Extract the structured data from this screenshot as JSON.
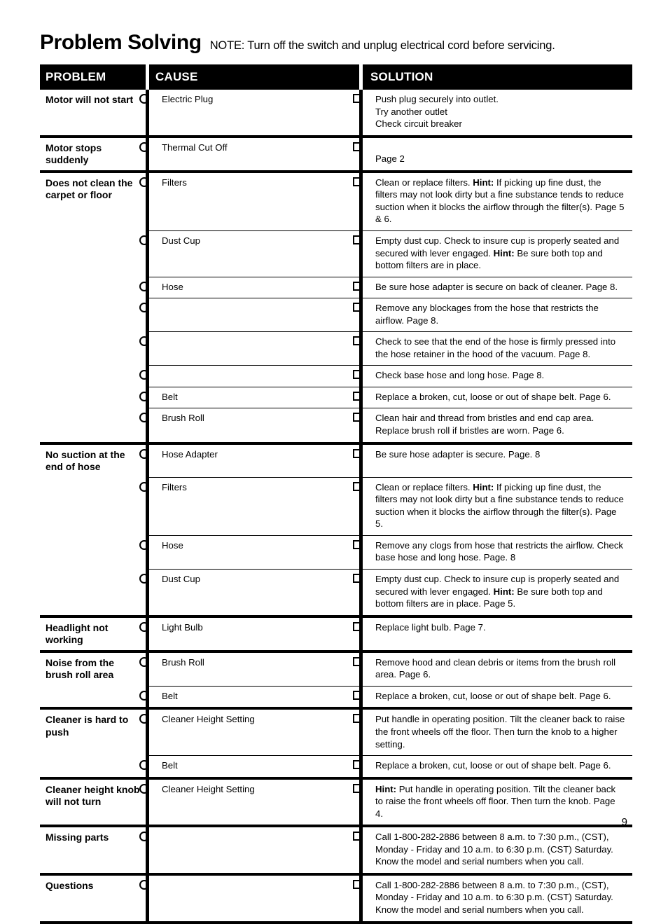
{
  "document": {
    "title": "Problem Solving",
    "note": "NOTE: Turn off the switch and unplug electrical cord before servicing.",
    "page_number": "9"
  },
  "table": {
    "headers": {
      "problem": "PROBLEM",
      "cause": "CAUSE",
      "solution": "SOLUTION"
    },
    "groups": [
      {
        "problem": "Motor will not start",
        "rows": [
          {
            "cause": "Electric Plug",
            "solution": "Push plug securely into outlet.\nTry another outlet\nCheck circuit breaker",
            "min_height": 56
          }
        ]
      },
      {
        "problem": "Motor stops suddenly",
        "rows": [
          {
            "cause": "Thermal Cut Off",
            "solution_lead": "",
            "solution": "Page 2",
            "min_height": 46,
            "solution_offset": true
          }
        ]
      },
      {
        "problem": "Does not clean the carpet or floor",
        "rows": [
          {
            "cause": "Filters",
            "solution_html": "Clean or replace filters. <b>Hint:</b> If picking up fine dust, the filters may not look dirty but a fine substance tends to reduce suction when it blocks the airflow through the filter(s). Page 5 &amp; 6.",
            "min_height": 59
          },
          {
            "cause": "Dust Cup",
            "solution_html": "Empty dust cup. Check to insure cup is properly seated and secured with lever engaged. <b>Hint:</b> Be sure both top and bottom filters are in place.",
            "min_height": 56
          },
          {
            "cause": "Hose",
            "solution_html": "Be sure hose adapter is secure on back of cleaner. Page 8.",
            "min_height": 28
          },
          {
            "cause": "",
            "solution_html": "Remove any blockages from the hose that restricts the airflow. Page 8.",
            "min_height": 37
          },
          {
            "cause": "",
            "solution_html": "Check to see that the end of the hose is firmly pressed into the hose retainer in the hood of the vacuum. Page 8.",
            "min_height": 38
          },
          {
            "cause": "",
            "solution_html": "Check base hose and long hose. Page 8.",
            "min_height": 26
          },
          {
            "cause": "Belt",
            "solution_html": "Replace a broken, cut, loose or out of shape belt. Page 6.",
            "min_height": 23
          },
          {
            "cause": "Brush Roll",
            "solution_html": "Clean hair and thread from bristles and end cap area. Replace brush roll if bristles are worn. Page 6.",
            "min_height": 44
          }
        ]
      },
      {
        "problem": "No suction at the end of hose",
        "rows": [
          {
            "cause": "Hose Adapter",
            "solution_html": "Be sure hose adapter is secure. Page. 8",
            "min_height": 30
          },
          {
            "cause": "Filters",
            "solution_html": "Clean or replace filters. <b>Hint:</b> If picking up fine dust, the filters may not look dirty but a fine substance tends to reduce suction when it blocks the airflow through the filter(s). Page 5.",
            "min_height": 56
          },
          {
            "cause": "Hose",
            "solution_html": "Remove any clogs from hose that restricts the airflow. Check base hose and long hose. Page. 8",
            "min_height": 42
          },
          {
            "cause": "Dust Cup",
            "solution_html": "Empty dust cup. Check to insure cup is properly seated and secured with lever engaged. <b>Hint:</b> Be sure both top and bottom filters are in place. Page 5.",
            "min_height": 52
          }
        ]
      },
      {
        "problem": "Headlight not working",
        "rows": [
          {
            "cause": "Light Bulb",
            "solution_html": "Replace light bulb. Page 7.",
            "min_height": 44
          }
        ]
      },
      {
        "problem": "Noise from the brush roll area",
        "rows": [
          {
            "cause": "Brush Roll",
            "solution_html": "Remove hood and clean debris or items from the brush roll area. Page 6.",
            "min_height": 40
          },
          {
            "cause": "Belt",
            "solution_html": "Replace a broken, cut, loose or out of shape belt. Page 6.",
            "min_height": 26
          }
        ]
      },
      {
        "problem": "Cleaner is hard to push",
        "rows": [
          {
            "cause": "Cleaner Height Setting",
            "solution_html": "Put handle in operating position. Tilt the cleaner back to raise the front wheels off the floor. Then turn the knob to a higher setting.",
            "min_height": 40
          },
          {
            "cause": "Belt",
            "solution_html": "Replace a broken, cut, loose or out of shape belt. Page 6.",
            "min_height": 26
          }
        ]
      },
      {
        "problem": "Cleaner height knob will not turn",
        "rows": [
          {
            "cause": "Cleaner Height Setting",
            "solution_html": "<b>Hint:</b> Put handle in operating position. Tilt the cleaner back to raise the front wheels off floor. Then turn the knob. Page 4.",
            "min_height": 40
          }
        ]
      },
      {
        "problem": "Missing parts",
        "rows": [
          {
            "cause": "",
            "solution_html": "Call 1-800-282-2886 between 8 a.m. to 7:30 p.m., (CST), Monday - Friday and 10 a.m. to 6:30 p.m. (CST) Saturday. Know the model and serial numbers when you call.",
            "min_height": 56
          }
        ]
      },
      {
        "problem": "Questions",
        "rows": [
          {
            "cause": "",
            "solution_html": "Call 1-800-282-2886 between 8 a.m. to 7:30 p.m., (CST), Monday - Friday and 10 a.m. to 6:30 p.m. (CST) Saturday. Know the model and serial numbers when you call.",
            "min_height": 56
          }
        ]
      }
    ]
  }
}
